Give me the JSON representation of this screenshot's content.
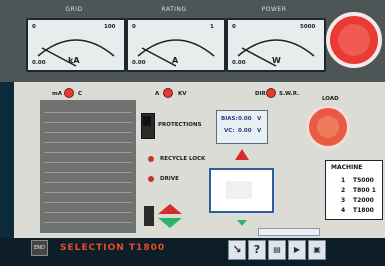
{
  "meters": {
    "grid": {
      "header": "GRID",
      "scale_min": "0",
      "scale_max": "100",
      "low": "0.00",
      "unit": "kA",
      "needle": 0.05
    },
    "rating": {
      "header": "RATING",
      "scale_min": "0",
      "scale_max": "1",
      "low": "0.00",
      "unit": "A",
      "needle": 0.05
    },
    "power": {
      "header": "POWER",
      "scale_min": "0",
      "scale_max": "5000",
      "low": "0.00",
      "unit": "W",
      "needle": 0.05
    }
  },
  "labels": {
    "ma": "mA",
    "c": "C",
    "a": "A",
    "kv": "KV",
    "dir": "DIR",
    "swr": "S.W.R.",
    "protections": "PROTECTIONS",
    "recycle_lock": "RECYCLE LOCK",
    "drive": "DRIVE",
    "load": "LOAD"
  },
  "bias": {
    "bias_label": "BIAS:",
    "bias_value": "0.00",
    "bias_unit": "V",
    "vc_label": "VC:",
    "vc_value": "0.00",
    "vc_unit": "V"
  },
  "machine_box": {
    "title": "MACHINE",
    "rows": [
      {
        "num": "1",
        "name": "T5000"
      },
      {
        "num": "2",
        "name": "T800 1"
      },
      {
        "num": "3",
        "name": "T2000"
      },
      {
        "num": "4",
        "name": "T1800"
      }
    ]
  },
  "bottom": {
    "end": "END",
    "status": "SELECTION T1800",
    "help": "?"
  }
}
